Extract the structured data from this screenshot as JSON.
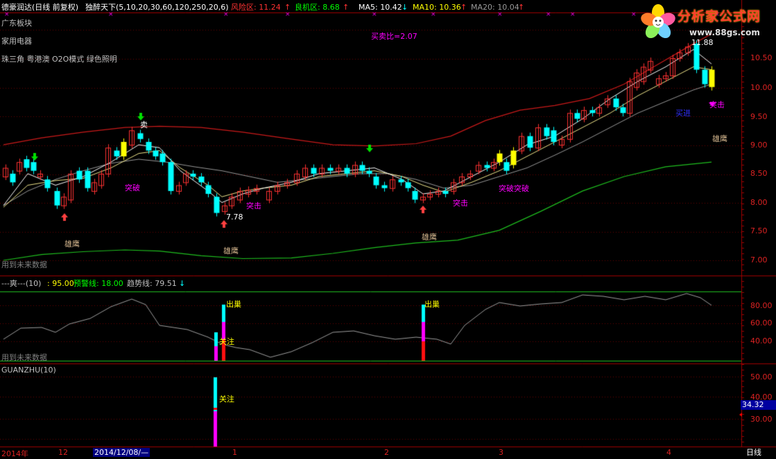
{
  "header": {
    "stock": "德豪润达(日线 前复权)",
    "indicator": "独醉天下(5,10,20,30,60,120,250,20,6)",
    "risk_label": "风险区: 11.24",
    "risk_arrow": "↑",
    "opportunity_label": "良机区: 8.68",
    "opportunity_arrow": "↑",
    "ma5": "MA5: 10.42",
    "ma5_arrow": "↓",
    "ma10": "MA10: 10.36",
    "ma10_arrow": "↑",
    "ma20": "MA20: 10.04",
    "ma20_arrow": "↑"
  },
  "sector": {
    "line1": "广东板块",
    "line2": "家用电器",
    "line3": "珠三角 粤港澳 O2O模式 绿色照明"
  },
  "buy_sell_ratio": "买卖比=2.07",
  "annotations": {
    "sell": "卖",
    "breakout": "突破",
    "strike": "突击",
    "breakout_breakout": "突破突破",
    "eagle": "雄鹰",
    "low_price": "7.78",
    "high_price": "11.88",
    "surge": "突击",
    "eagle2": "雄鹰",
    "blue_tag": "买进",
    "future_data": "用到未来数据"
  },
  "price_axis": [
    "10.50",
    "10.00",
    "9.50",
    "9.00",
    "8.50",
    "8.00",
    "7.50",
    "7.00"
  ],
  "panel2": {
    "title": "---爽---(10)",
    "value1": ": 95.00",
    "warn": "预警线: 18.00",
    "trend": "趋势线: 79.51",
    "trend_arrow": "↓",
    "out": "出巢",
    "focus": "关注",
    "future_data": "用到未来数据",
    "axis": [
      "80.00",
      "60.00",
      "40.00"
    ]
  },
  "panel3": {
    "title": "GUANZHU(10)",
    "focus": "关注",
    "axis": [
      "50.00",
      "40.00",
      "30.00"
    ],
    "current_value": "34.32"
  },
  "date_axis": {
    "year": "2014年",
    "m12": "12",
    "cursor_date": "2014/12/08/—",
    "m1": "1",
    "m2": "2",
    "m3": "3",
    "m4": "4"
  },
  "period": "日线",
  "logo": {
    "name": "分析家公式网",
    "url": "www.88gs.com"
  },
  "colors": {
    "up": "#ff3232",
    "down": "#00ffff",
    "yellow": "#ffff00",
    "magenta": "#ff00ff",
    "green_line": "#00c000",
    "red_line": "#cc0000",
    "grid": "#800000"
  }
}
